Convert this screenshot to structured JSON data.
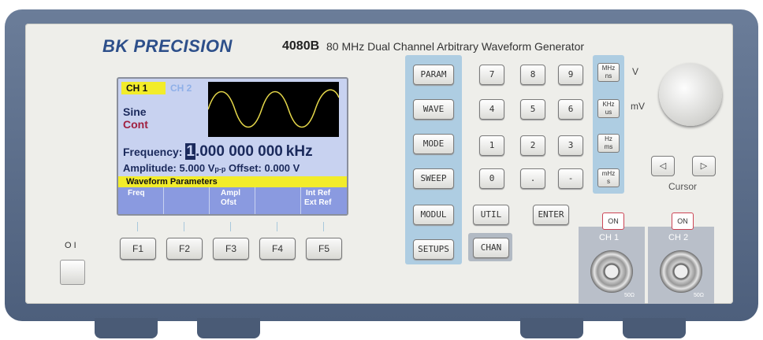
{
  "brand": "BK PRECISION",
  "model": "4080B",
  "description": "80 MHz Dual Channel Arbitrary Waveform Generator",
  "display": {
    "tab_ch1": "CH 1",
    "tab_ch2": "CH 2",
    "waveform": "Sine",
    "mode": "Cont",
    "frequency_label": "Frequency:",
    "frequency_cursor_digit": "1",
    "frequency_value": ".000 000 000",
    "frequency_unit": "kHz",
    "amplitude_label": "Amplitude:",
    "amplitude_value": "5.000",
    "amplitude_unit": "V",
    "amplitude_subscript": "p-p",
    "offset_label": "Offset:",
    "offset_value": "0.000 V",
    "menu_title": "Waveform Parameters",
    "softkeys": {
      "sk1": "Freq",
      "sk3_top": "Ampl",
      "sk3_bottom": "Ofst",
      "sk5_top": "Int Ref",
      "sk5_bottom": "Ext Ref"
    }
  },
  "function_keys": [
    "F1",
    "F2",
    "F3",
    "F4",
    "F5"
  ],
  "menu_buttons": [
    "PARAM",
    "WAVE",
    "MODE",
    "SWEEP",
    "MODUL",
    "SETUPS"
  ],
  "keypad": [
    "7",
    "8",
    "9",
    "4",
    "5",
    "6",
    "1",
    "2",
    "3",
    "0",
    ".",
    "-"
  ],
  "util_label": "UTIL",
  "chan_label": "CHAN",
  "enter_label": "ENTER",
  "units": [
    {
      "top": "MHz",
      "bottom": "ns",
      "side": "V"
    },
    {
      "top": "KHz",
      "bottom": "us",
      "side": "mV"
    },
    {
      "top": "Hz",
      "bottom": "ms",
      "side": ""
    },
    {
      "top": "mHz",
      "bottom": "s",
      "side": ""
    }
  ],
  "cursor_label": "Cursor",
  "cursor_left": "◁",
  "cursor_right": "▷",
  "channels": [
    {
      "on_label": "ON",
      "name": "CH 1",
      "impedance": "50Ω"
    },
    {
      "on_label": "ON",
      "name": "CH 2",
      "impedance": "50Ω"
    }
  ],
  "power_symbols": "O I",
  "colors": {
    "case": "#566884",
    "panel": "#eeeeea",
    "screen": "#c8d2f0",
    "accent_yellow": "#f2ec2a",
    "key_panel": "#aecde2",
    "brand": "#2d4f8a"
  }
}
